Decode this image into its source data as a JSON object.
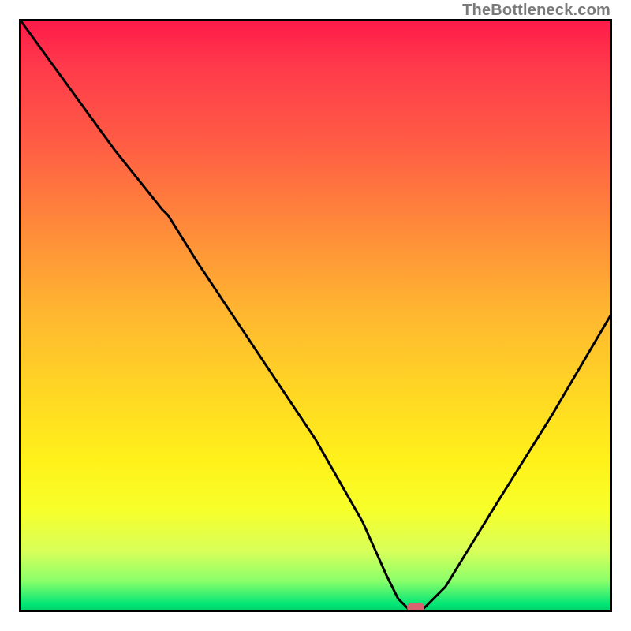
{
  "watermark": "TheBottleneck.com",
  "colors": {
    "curve": "#000000",
    "marker": "#d6636f",
    "border": "#000000"
  },
  "chart_data": {
    "type": "line",
    "title": "",
    "xlabel": "",
    "ylabel": "",
    "xlim": [
      0,
      100
    ],
    "ylim": [
      0,
      100
    ],
    "grid": false,
    "legend": false,
    "series": [
      {
        "name": "bottleneck-curve",
        "x": [
          0,
          8,
          16,
          24,
          25,
          30,
          40,
          50,
          58,
          62,
          64,
          66,
          68,
          72,
          80,
          90,
          100
        ],
        "y": [
          100,
          89,
          78,
          68,
          67,
          59,
          44,
          29,
          15,
          6,
          2,
          0,
          0,
          4,
          17,
          33,
          50
        ]
      }
    ],
    "marker": {
      "x": 67,
      "y": 0.5
    },
    "background_gradient_stops": [
      {
        "pos": 0,
        "color": "#ff1a4a"
      },
      {
        "pos": 8,
        "color": "#ff3b4b"
      },
      {
        "pos": 20,
        "color": "#ff5a45"
      },
      {
        "pos": 35,
        "color": "#ff8a3a"
      },
      {
        "pos": 50,
        "color": "#ffb830"
      },
      {
        "pos": 64,
        "color": "#ffd923"
      },
      {
        "pos": 75,
        "color": "#fff21a"
      },
      {
        "pos": 83,
        "color": "#f7ff2a"
      },
      {
        "pos": 90,
        "color": "#d8ff5a"
      },
      {
        "pos": 95,
        "color": "#8aff6a"
      },
      {
        "pos": 99,
        "color": "#00e676"
      },
      {
        "pos": 100,
        "color": "#00d26a"
      }
    ]
  }
}
